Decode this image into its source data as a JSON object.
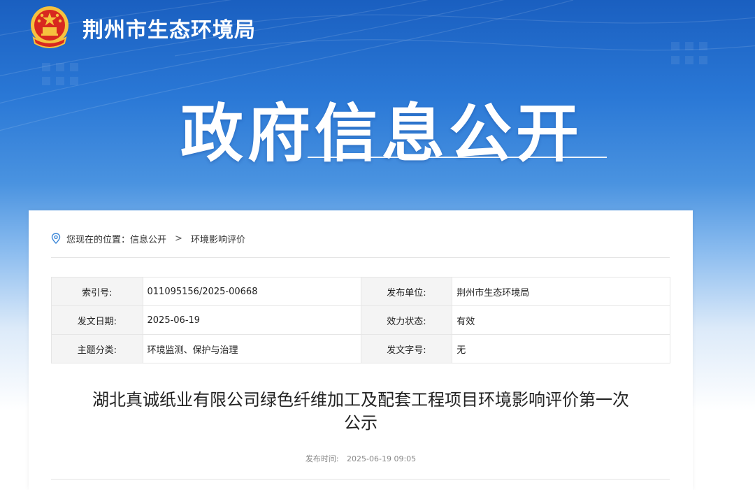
{
  "header": {
    "site_title": "荆州市生态环境局",
    "hero_title": "政府信息公开"
  },
  "breadcrumb": {
    "prefix": "您现在的位置：",
    "items": [
      "信息公开",
      "环境影响评价"
    ],
    "separator": ">"
  },
  "meta": {
    "rows": [
      {
        "k1": "索引号:",
        "v1": "011095156/2025-00668",
        "k2": "发布单位:",
        "v2": "荆州市生态环境局"
      },
      {
        "k1": "发文日期:",
        "v1": "2025-06-19",
        "k2": "效力状态:",
        "v2": "有效"
      },
      {
        "k1": "主题分类:",
        "v1": "环境监测、保护与治理",
        "k2": "发文字号:",
        "v2": "无"
      }
    ]
  },
  "article": {
    "title_line1": "湖北真诚纸业有限公司绿色纤维加工及配套工程项目环境影响评价第一次",
    "title_line2": "公示",
    "pub_label": "发布时间:",
    "pub_time": "2025-06-19 09:05"
  },
  "colors": {
    "banner_top": "#1a5fc0",
    "accent_blue": "#2a78d6"
  },
  "icons": {
    "emblem": "national-emblem-icon",
    "location": "location-pin-icon"
  }
}
